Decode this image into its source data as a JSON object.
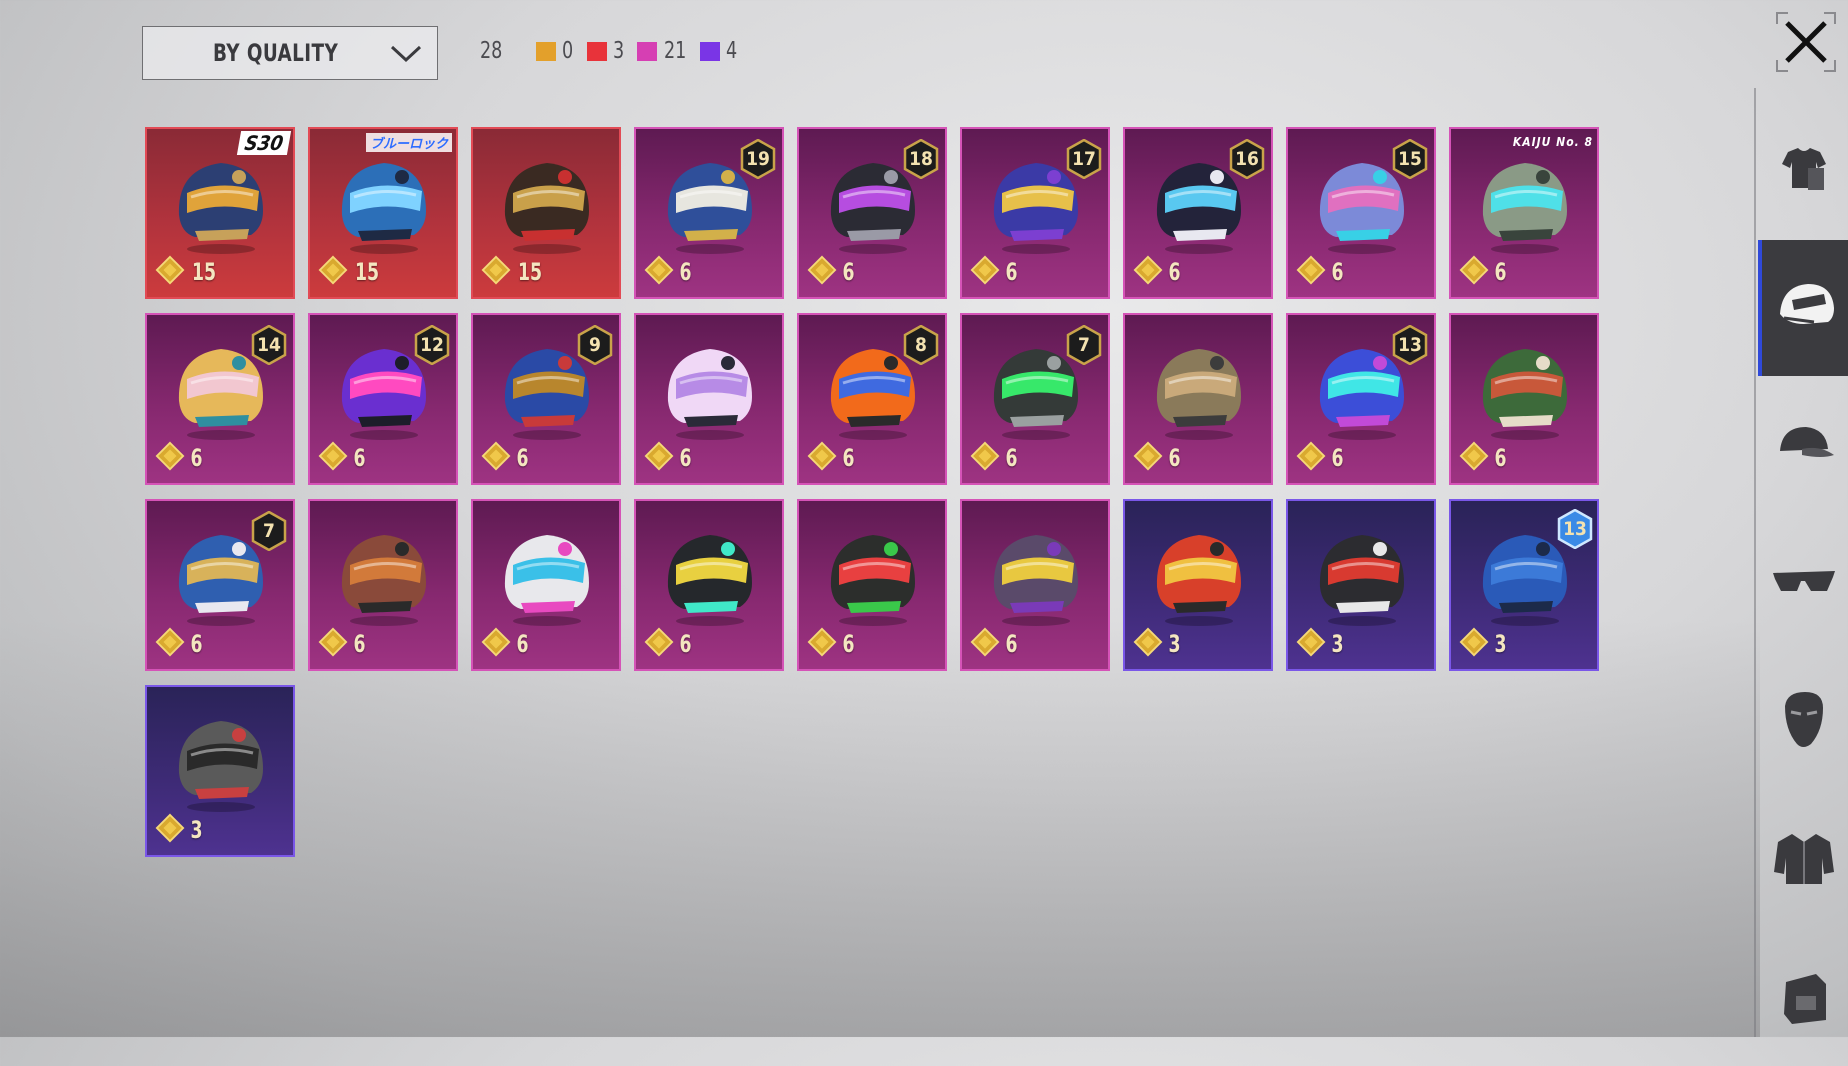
{
  "sort": {
    "label": "BY QUALITY"
  },
  "counts": {
    "total": "28",
    "qualities": [
      {
        "color": "#e3a02b",
        "count": "0"
      },
      {
        "color": "#e8333a",
        "count": "3"
      },
      {
        "color": "#d63fb3",
        "count": "21"
      },
      {
        "color": "#7a35e6",
        "count": "4"
      }
    ]
  },
  "sidebar": {
    "items": [
      {
        "name": "outfit",
        "icon": "outfit-icon",
        "active": false
      },
      {
        "name": "helmet",
        "icon": "helmet-icon",
        "active": true
      },
      {
        "name": "hat",
        "icon": "cap-icon",
        "active": false
      },
      {
        "name": "glasses",
        "icon": "glasses-icon",
        "active": false
      },
      {
        "name": "mask",
        "icon": "mask-icon",
        "active": false
      },
      {
        "name": "jacket",
        "icon": "jacket-icon",
        "active": false
      },
      {
        "name": "backpack",
        "icon": "backpack-icon",
        "active": false
      }
    ]
  },
  "items": [
    {
      "quality": "red",
      "price": "15",
      "tag": "S30",
      "colors": [
        "#2c3f73",
        "#e0a33a",
        "#c7a15a"
      ]
    },
    {
      "quality": "red",
      "price": "15",
      "tag": "ブルーロック",
      "colors": [
        "#2c6fb8",
        "#7fd2ff",
        "#1e2a44"
      ]
    },
    {
      "quality": "red",
      "price": "15",
      "colors": [
        "#3a2a22",
        "#c9a04a",
        "#c83030"
      ]
    },
    {
      "quality": "pink",
      "price": "6",
      "level": "19",
      "colors": [
        "#2f4f9a",
        "#e7e6df",
        "#d2b04a"
      ]
    },
    {
      "quality": "pink",
      "price": "6",
      "level": "18",
      "colors": [
        "#2b2b34",
        "#b64de0",
        "#9a9aa6"
      ]
    },
    {
      "quality": "pink",
      "price": "6",
      "level": "17",
      "colors": [
        "#3b3aa6",
        "#e7c04a",
        "#7c3fd1"
      ]
    },
    {
      "quality": "pink",
      "price": "6",
      "level": "16",
      "colors": [
        "#23233a",
        "#59c8f0",
        "#e8e8f0"
      ]
    },
    {
      "quality": "pink",
      "price": "6",
      "level": "15",
      "colors": [
        "#7c8ad8",
        "#e070c0",
        "#38d0e6"
      ]
    },
    {
      "quality": "pink",
      "price": "6",
      "tag": "KAIJU No. 8",
      "colors": [
        "#8a9a86",
        "#4fe0e8",
        "#39443c"
      ]
    },
    {
      "quality": "pink",
      "price": "6",
      "level": "14",
      "colors": [
        "#e6b85a",
        "#f2c7d0",
        "#2f8fa0"
      ]
    },
    {
      "quality": "pink",
      "price": "6",
      "level": "12",
      "colors": [
        "#6a2fd0",
        "#ff4ac0",
        "#1d1d2a"
      ]
    },
    {
      "quality": "pink",
      "price": "6",
      "level": "9",
      "colors": [
        "#2a4aa6",
        "#b8862d",
        "#c83a3a"
      ]
    },
    {
      "quality": "pink",
      "price": "6",
      "colors": [
        "#f0d8f6",
        "#b78be6",
        "#2a2a38"
      ]
    },
    {
      "quality": "pink",
      "price": "6",
      "level": "8",
      "colors": [
        "#f26a1b",
        "#3f6ae0",
        "#2a2a2a"
      ]
    },
    {
      "quality": "pink",
      "price": "6",
      "level": "7",
      "colors": [
        "#343a38",
        "#37e86a",
        "#9aa0a0"
      ]
    },
    {
      "quality": "pink",
      "price": "6",
      "colors": [
        "#8a7a5a",
        "#c9a97a",
        "#3c3c3c"
      ]
    },
    {
      "quality": "pink",
      "price": "6",
      "level": "13",
      "colors": [
        "#3c4ed8",
        "#40e6e6",
        "#c24ad8"
      ]
    },
    {
      "quality": "pink",
      "price": "6",
      "colors": [
        "#3d6a3a",
        "#c8583a",
        "#e6dcc8"
      ]
    },
    {
      "quality": "pink",
      "price": "6",
      "level": "7",
      "colors": [
        "#2f5fb0",
        "#d8b25a",
        "#e8e8f0"
      ]
    },
    {
      "quality": "pink",
      "price": "6",
      "colors": [
        "#8a4a3a",
        "#d27a3a",
        "#2a2a2a"
      ]
    },
    {
      "quality": "pink",
      "price": "6",
      "colors": [
        "#e8e8ec",
        "#3ac0e8",
        "#e84ac0"
      ]
    },
    {
      "quality": "pink",
      "price": "6",
      "colors": [
        "#25282c",
        "#e8d040",
        "#40e8c8"
      ]
    },
    {
      "quality": "pink",
      "price": "6",
      "colors": [
        "#2c2e2c",
        "#e84040",
        "#3ac84a"
      ]
    },
    {
      "quality": "pink",
      "price": "6",
      "colors": [
        "#5a4a6a",
        "#e8c840",
        "#7a3ab8"
      ]
    },
    {
      "quality": "purple",
      "price": "3",
      "colors": [
        "#d8402a",
        "#f0c040",
        "#2a2a2a"
      ]
    },
    {
      "quality": "purple",
      "price": "3",
      "colors": [
        "#2c2c30",
        "#d83a30",
        "#e8e8e8"
      ]
    },
    {
      "quality": "purple",
      "price": "3",
      "level": "13",
      "badge_color": "#3a8ae6",
      "colors": [
        "#2a5ab8",
        "#3c7ad8",
        "#1c2a4a"
      ]
    },
    {
      "quality": "purple",
      "price": "3",
      "colors": [
        "#5a5a5a",
        "#2a2a2a",
        "#c84040"
      ]
    }
  ]
}
